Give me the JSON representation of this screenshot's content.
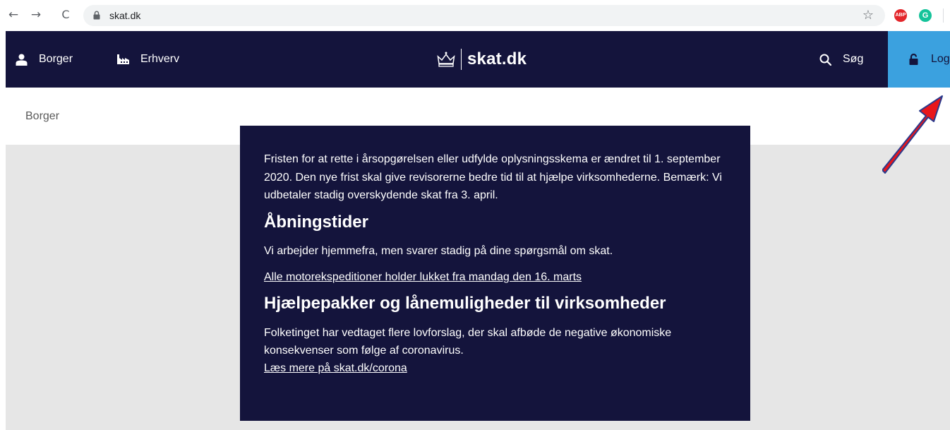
{
  "browser": {
    "url": "skat.dk",
    "extensions": {
      "adblock": "ABP",
      "grammarly": "G"
    }
  },
  "header": {
    "borger": "Borger",
    "erhverv": "Erhverv",
    "logo": "skat.dk",
    "search": "Søg",
    "login": "Log"
  },
  "breadcrumb": "Borger",
  "notice": {
    "intro": "Fristen for at rette i årsopgørelsen eller udfylde oplysningsskema er ændret til 1. september 2020. Den nye frist skal give revisorerne bedre tid til at hjælpe virksomhederne. Bemærk: Vi udbetaler stadig overskydende skat fra 3. april.",
    "heading1": "Åbningstider",
    "text1": "Vi arbejder hjemmefra, men svarer stadig på dine spørgsmål om skat.",
    "link1": "Alle motorekspeditioner holder lukket fra mandag den 16. marts",
    "heading2": "Hjælpepakker og lånemuligheder til virksomheder",
    "text2": "Folketinget har vedtaget flere lovforslag, der skal afbøde de negative økonomiske konsekvenser som følge af coronavirus.",
    "link2": "Læs mere på skat.dk/corona"
  },
  "colors": {
    "header_bg": "#14143c",
    "login_bg": "#3ba1df",
    "content_bg": "#e6e6e6",
    "arrow": "#e8161b"
  }
}
